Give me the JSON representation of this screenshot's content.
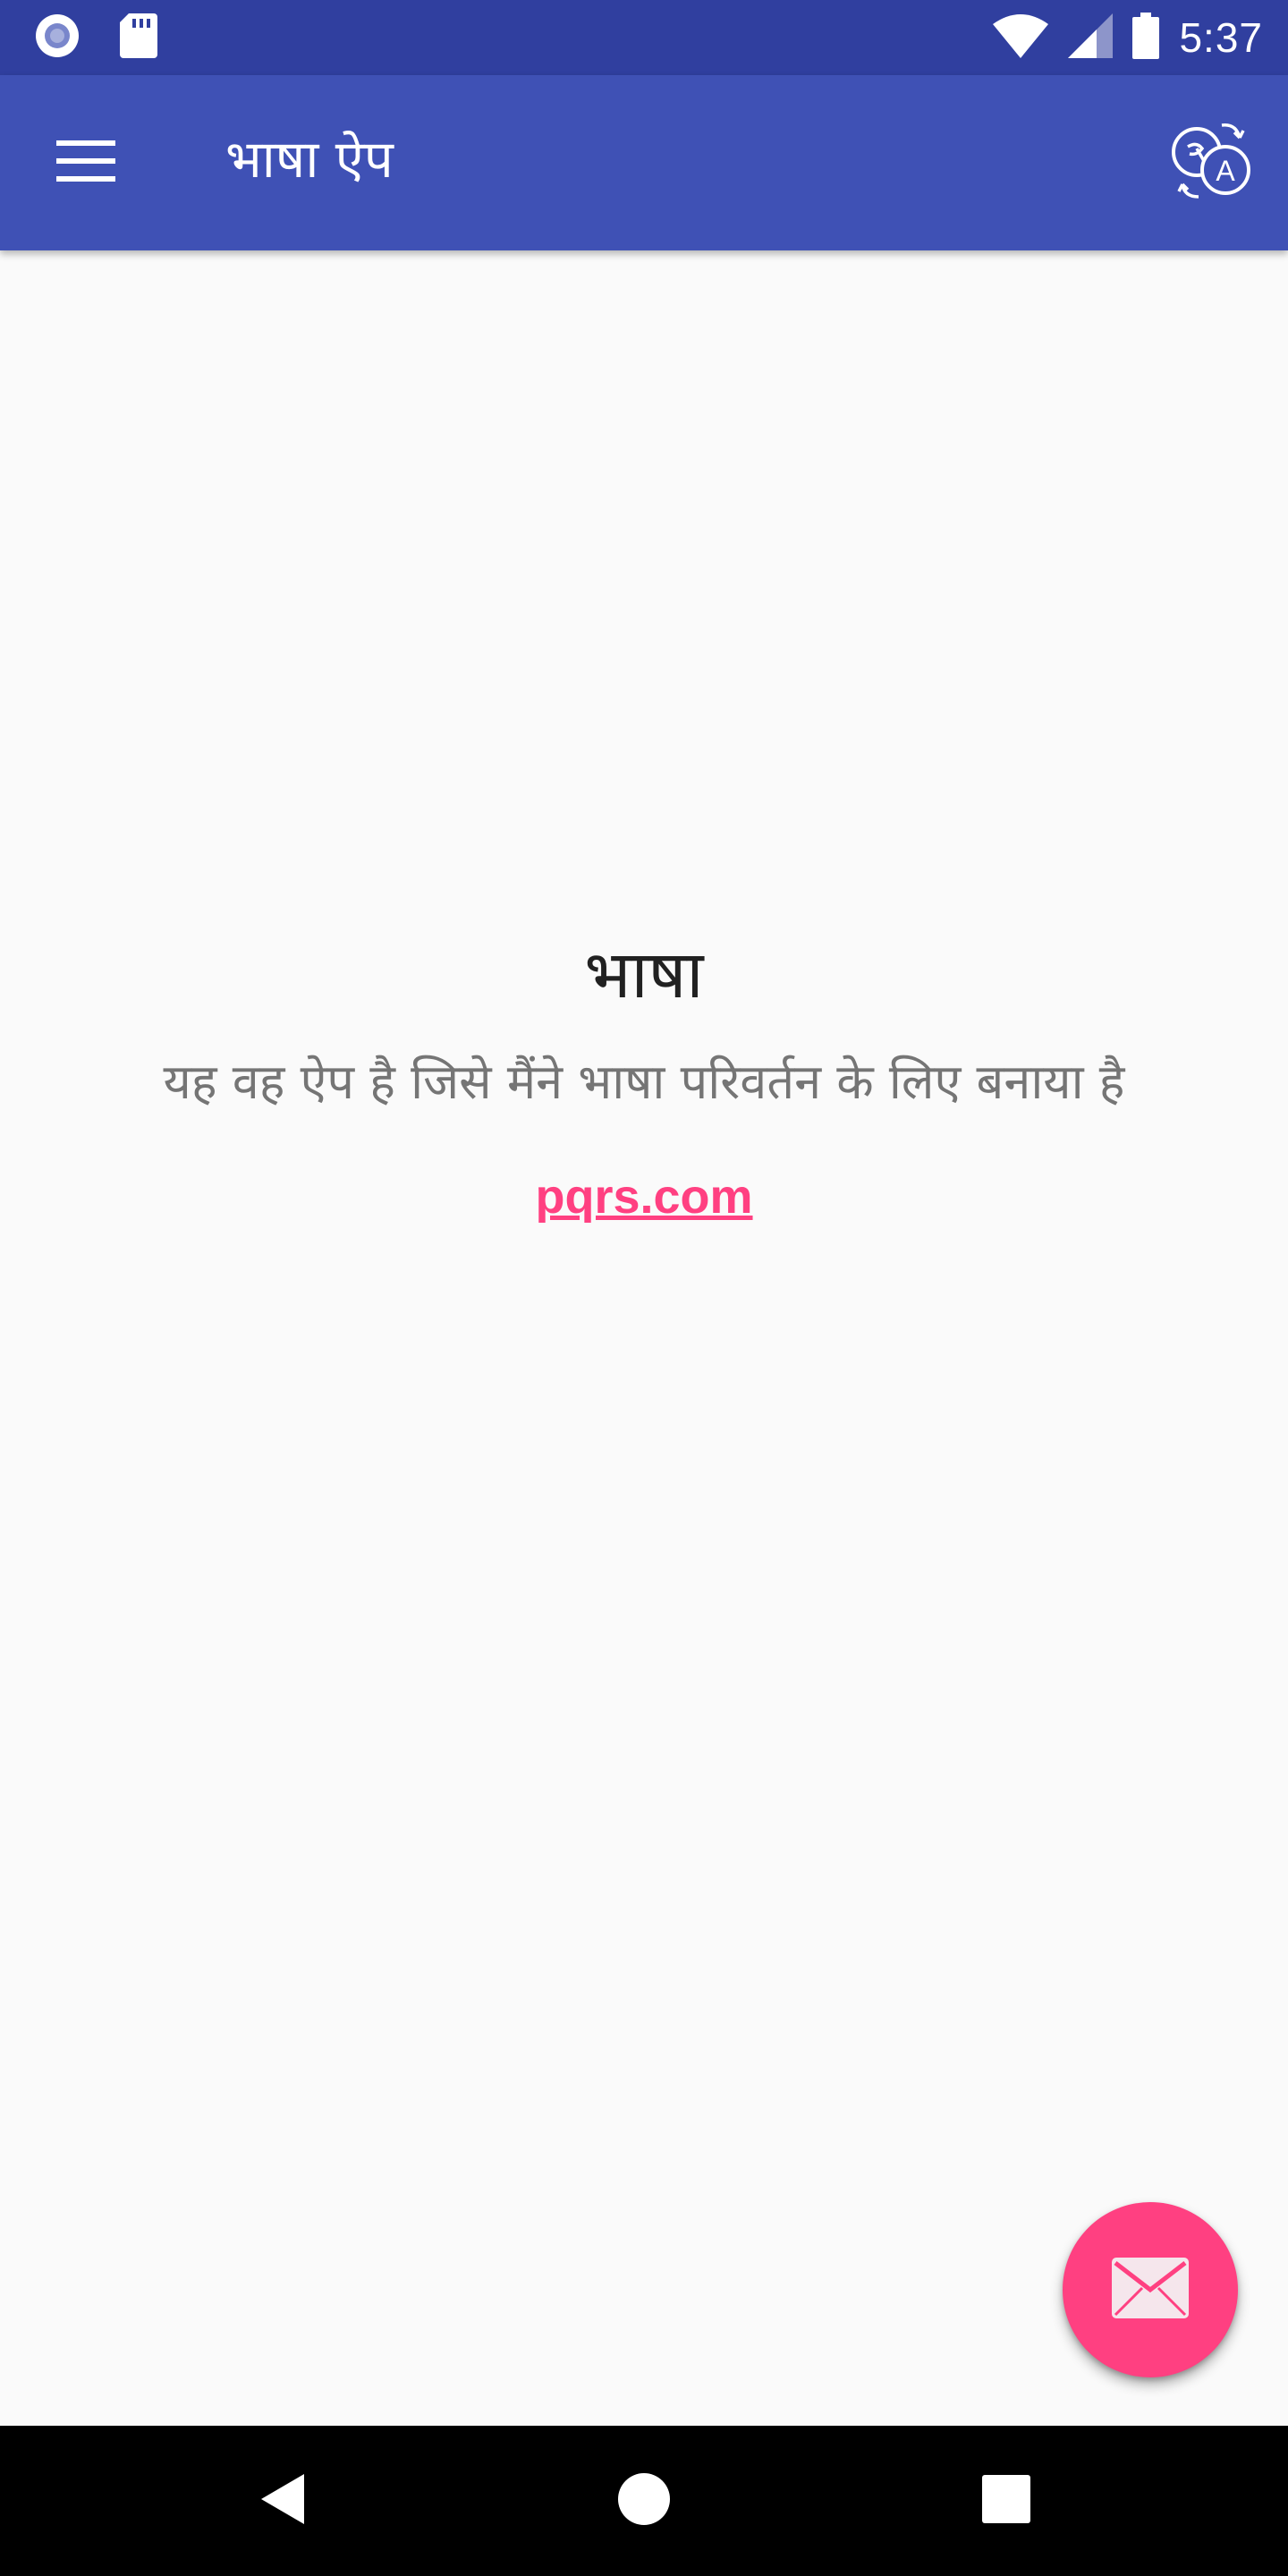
{
  "status_bar": {
    "time": "5:37",
    "icons": [
      "notification-circle-icon",
      "sd-card-icon",
      "wifi-icon",
      "cell-signal-icon",
      "battery-icon"
    ]
  },
  "app_bar": {
    "title": "भाषा ऐप",
    "menu_icon": "menu-icon",
    "action_icon": "translate-icon",
    "color": "#3F51B5"
  },
  "main": {
    "heading": "भाषा",
    "description": "यह वह ऐप है जिसे मैंने भाषा परिवर्तन के लिए बनाया है",
    "link": "pqrs.com",
    "link_color": "#FF4081"
  },
  "fab": {
    "icon": "mail-icon",
    "color": "#FF4081"
  },
  "nav_bar": {
    "buttons": [
      "back-icon",
      "home-icon",
      "recent-apps-icon"
    ]
  }
}
